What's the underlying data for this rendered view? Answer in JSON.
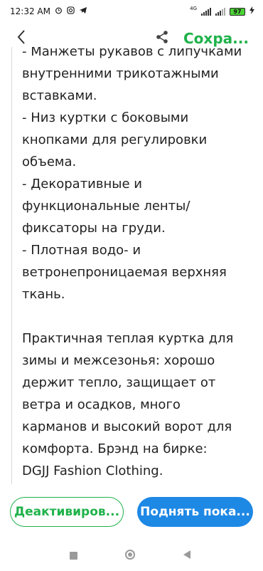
{
  "status_bar": {
    "time": "12:32 AM",
    "network_label": "4G",
    "battery": "97",
    "icons": [
      "alarm-icon",
      "instagram-icon",
      "telegram-icon",
      "signal-icon",
      "battery-icon",
      "charging-icon"
    ]
  },
  "app_bar": {
    "back_icon": "chevron-left-icon",
    "share_icon": "share-icon",
    "save_label": "Сохра..."
  },
  "content": {
    "lines": [
      "- Манжеты рукавов с липучками",
      "внутренними трикотажными",
      "вставками.",
      "- Низ куртки с боковыми",
      "кнопками для регулировки",
      "объема.",
      "- Декоративные и",
      "функциональные ленты/",
      "фиксаторы на груди.",
      "- Плотная водо- и",
      "ветронепроницаемая верхняя",
      "ткань.",
      "",
      "Практичная теплая куртка для",
      "зимы и межсезонья: хорошо",
      "держит тепло, защищает от",
      "ветра и осадков, много",
      "карманов и высокий ворот для",
      "комфорта. Брэнд на бирке:",
      "DGJJ Fashion Clothing."
    ]
  },
  "bottom_actions": {
    "deactivate_label": "Деактивиров...",
    "raise_label": "Поднять пока..."
  },
  "colors": {
    "accent_green": "#1fb24a",
    "accent_blue": "#1e88e5"
  }
}
